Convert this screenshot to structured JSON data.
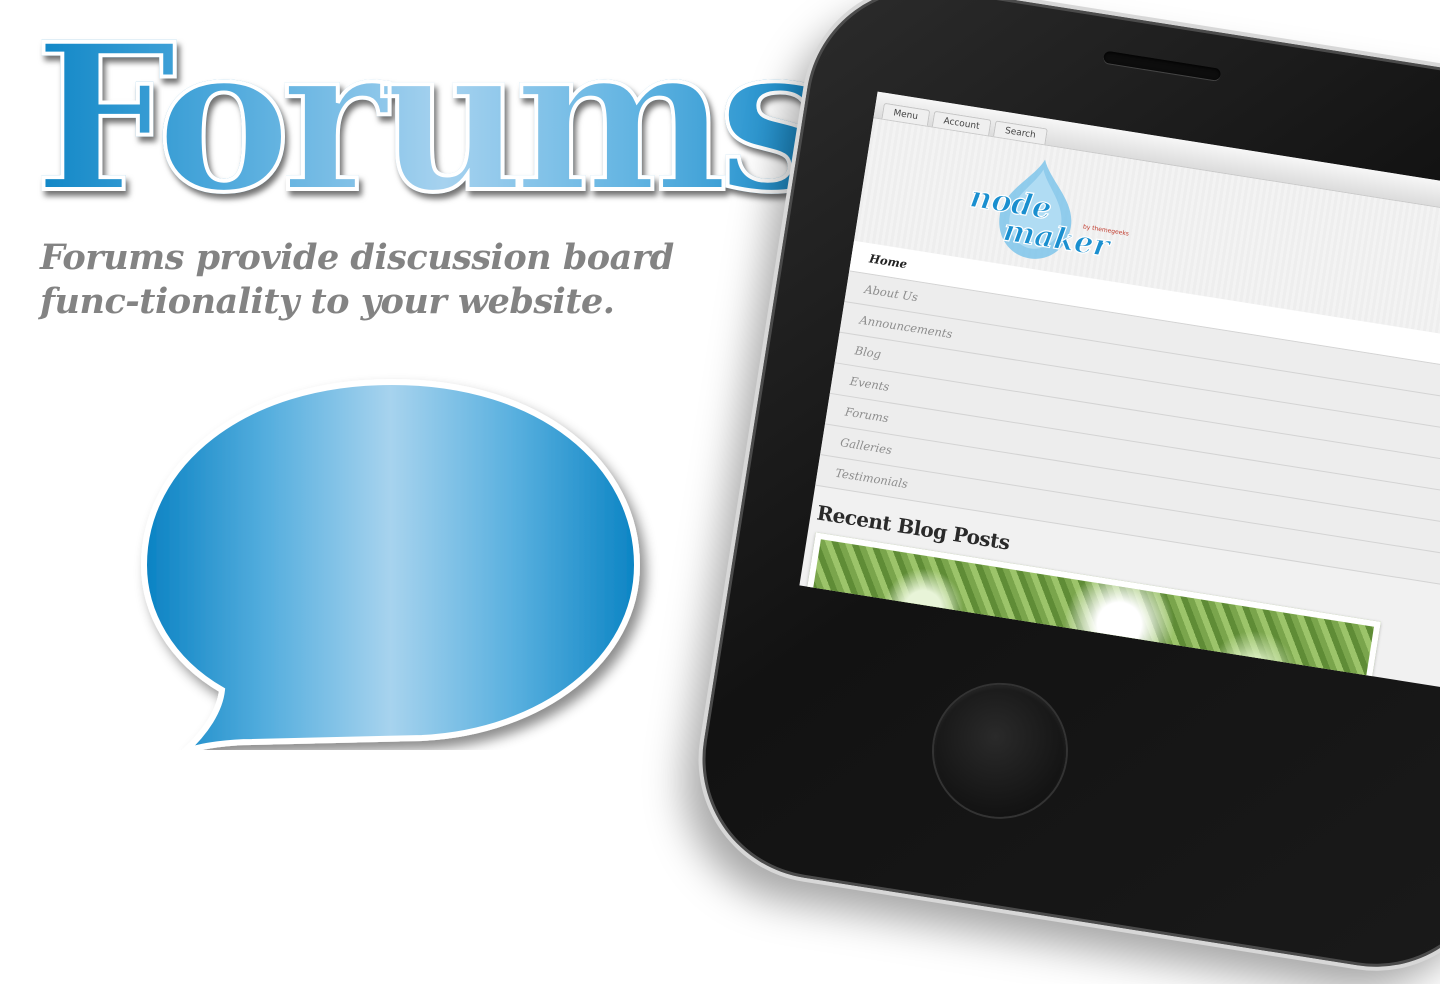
{
  "headline": "Forums",
  "tagline": "Forums provide discussion board func-tionality to your website.",
  "phone": {
    "topbar": [
      "Menu",
      "Account",
      "Search"
    ],
    "logo": {
      "line1": "node",
      "line2": "maker",
      "byline": "by themegeeks"
    },
    "menu": [
      {
        "label": "Home",
        "active": true,
        "has_submenu": false
      },
      {
        "label": "About Us",
        "active": false,
        "has_submenu": false
      },
      {
        "label": "Announcements",
        "active": false,
        "has_submenu": false
      },
      {
        "label": "Blog",
        "active": false,
        "has_submenu": true
      },
      {
        "label": "Events",
        "active": false,
        "has_submenu": true
      },
      {
        "label": "Forums",
        "active": false,
        "has_submenu": true
      },
      {
        "label": "Galleries",
        "active": false,
        "has_submenu": true
      },
      {
        "label": "Testimonials",
        "active": false,
        "has_submenu": false
      }
    ],
    "section_title": "Recent Blog Posts"
  },
  "colors": {
    "brand_blue": "#0f86c6",
    "light_blue": "#a6d2ef",
    "tagline_gray": "#838383"
  },
  "icons": {
    "bubble": "speech-bubble-icon",
    "arrow": "chevron-down-icon"
  }
}
